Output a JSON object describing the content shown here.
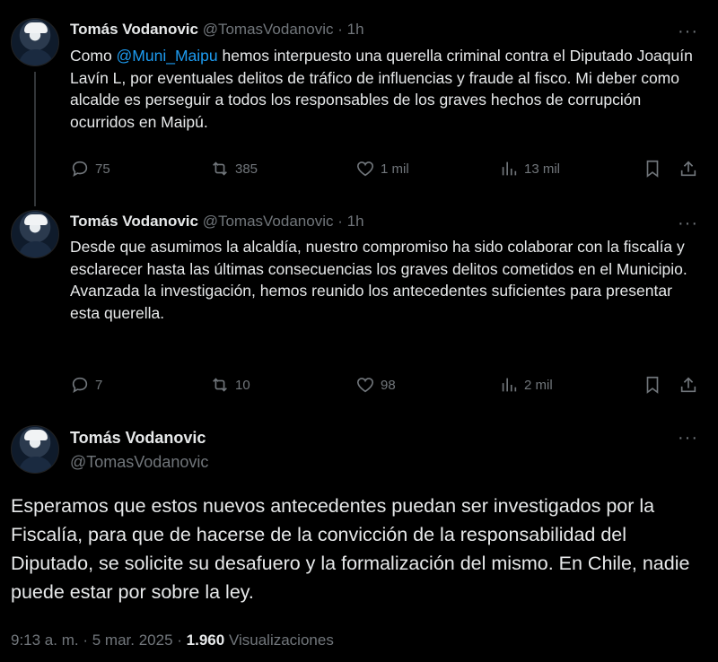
{
  "tweets": [
    {
      "name": "Tomás Vodanovic",
      "handle": "@TomasVodanovic",
      "sep": "·",
      "time": "1h",
      "more": "···",
      "text_before": "Como ",
      "mention": "@Muni_Maipu",
      "text_after": " hemos interpuesto una querella criminal contra el Diputado Joaquín Lavín L, por eventuales delitos de tráfico de influencias y fraude al fisco. Mi deber como alcalde es perseguir a todos los responsables de los graves hechos de corrupción ocurridos en Maipú.",
      "replies": "75",
      "retweets": "385",
      "likes": "1 mil",
      "views": "13 mil"
    },
    {
      "name": "Tomás Vodanovic",
      "handle": "@TomasVodanovic",
      "sep": "·",
      "time": "1h",
      "more": "···",
      "text": "Desde que asumimos la alcaldía, nuestro compromiso ha sido colaborar con la fiscalía y esclarecer hasta las últimas consecuencias los graves delitos cometidos en el Municipio.\nAvanzada la investigación, hemos reunido los antecedentes suficientes para presentar esta querella.",
      "replies": "7",
      "retweets": "10",
      "likes": "98",
      "views": "2 mil"
    }
  ],
  "main_tweet": {
    "name": "Tomás Vodanovic",
    "handle": "@TomasVodanovic",
    "more": "···",
    "text": "Esperamos que estos nuevos antecedentes puedan ser investigados por la Fiscalía, para que de hacerse de la convicción de la responsabilidad del Diputado, se solicite su desafuero y la formalización del mismo. En Chile, nadie puede estar por sobre la ley.",
    "time": "9:13 a. m.",
    "date": "5 mar. 2025",
    "views_count": "1.960",
    "views_label": "Visualizaciones",
    "dot": "·"
  },
  "icons": [
    "reply-icon",
    "retweet-icon",
    "like-icon",
    "views-icon",
    "bookmark-icon",
    "share-icon",
    "more-icon"
  ],
  "colors": {
    "background": "#000000",
    "text": "#e7e9ea",
    "secondary": "#71767b",
    "link": "#1d9bf0"
  }
}
